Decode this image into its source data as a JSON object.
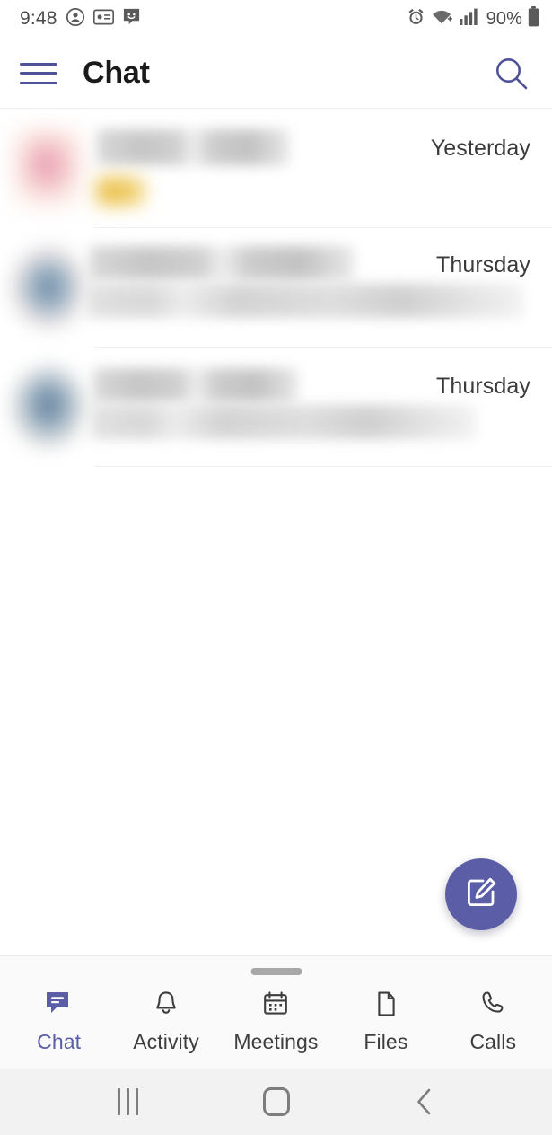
{
  "status_bar": {
    "time": "9:48",
    "battery_percent": "90%",
    "left_icons": [
      "account-circle-icon",
      "contact-card-icon",
      "smiley-message-icon"
    ],
    "right_icons": [
      "alarm-clock-icon",
      "wifi-icon",
      "cellular-signal-icon",
      "battery-icon"
    ]
  },
  "app_bar": {
    "menu_icon": "hamburger-menu-icon",
    "title": "Chat",
    "search_icon": "search-icon",
    "accent_color": "#4f5296"
  },
  "chat_list": {
    "rows": [
      {
        "avatar_type": "blurred-pink-avatar",
        "name": "",
        "preview": "",
        "timestamp": "Yesterday",
        "has_badge": true,
        "badge_color": "#e8b93b",
        "redacted": true
      },
      {
        "avatar_type": "blurred-photo-avatar",
        "name": "",
        "preview": "",
        "timestamp": "Thursday",
        "has_badge": false,
        "redacted": true
      },
      {
        "avatar_type": "blurred-photo-avatar",
        "name": "",
        "preview": "",
        "timestamp": "Thursday",
        "has_badge": false,
        "redacted": true
      }
    ]
  },
  "fab": {
    "icon": "compose-edit-icon",
    "color": "#5b5ea6"
  },
  "bottom_nav": {
    "active": "Chat",
    "accent_color": "#5b5ea6",
    "inactive_color": "#3d3d3d",
    "items": [
      {
        "label": "Chat",
        "icon": "chat-bubble-icon",
        "active": true
      },
      {
        "label": "Activity",
        "icon": "bell-icon",
        "active": false
      },
      {
        "label": "Meetings",
        "icon": "calendar-icon",
        "active": false
      },
      {
        "label": "Files",
        "icon": "file-page-icon",
        "active": false
      },
      {
        "label": "Calls",
        "icon": "phone-handset-icon",
        "active": false
      }
    ]
  },
  "system_nav": {
    "recents_icon": "recent-apps-icon",
    "home_icon": "home-icon",
    "back_icon": "back-chevron-icon"
  }
}
